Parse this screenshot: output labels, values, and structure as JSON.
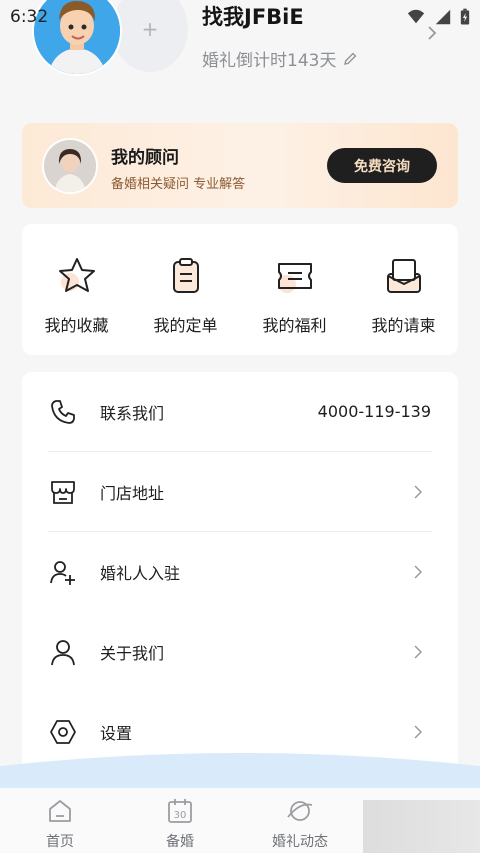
{
  "status_bar": {
    "time": "6:32"
  },
  "profile": {
    "name": "找我JFBiE",
    "countdown": "婚礼倒计时143天",
    "add_symbol": "+"
  },
  "advisor": {
    "title": "我的顾问",
    "subtitle": "备婚相关疑问 专业解答",
    "button": "免费咨询"
  },
  "quick_actions": [
    {
      "label": "我的收藏",
      "icon": "star-icon"
    },
    {
      "label": "我的定单",
      "icon": "clipboard-icon"
    },
    {
      "label": "我的福利",
      "icon": "ticket-icon"
    },
    {
      "label": "我的请柬",
      "icon": "invitation-icon"
    }
  ],
  "menu": [
    {
      "label": "联系我们",
      "value": "4000-119-139",
      "icon": "phone-icon"
    },
    {
      "label": "门店地址",
      "icon": "store-icon"
    },
    {
      "label": "婚礼人入驻",
      "icon": "add-user-icon"
    },
    {
      "label": "关于我们",
      "icon": "person-icon"
    },
    {
      "label": "设置",
      "icon": "settings-icon"
    }
  ],
  "bottom_nav": [
    {
      "label": "首页",
      "icon": "home-icon"
    },
    {
      "label": "备婚",
      "icon": "calendar-icon",
      "icon_text": "30"
    },
    {
      "label": "婚礼动态",
      "icon": "planet-icon"
    }
  ]
}
